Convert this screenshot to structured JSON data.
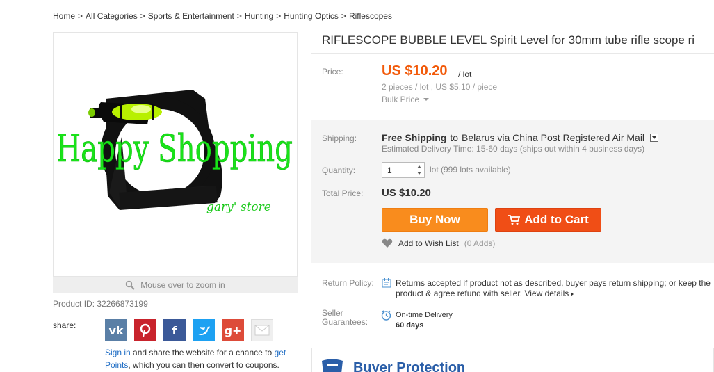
{
  "breadcrumb": [
    "Home",
    "All Categories",
    "Sports & Entertainment",
    "Hunting",
    "Hunting Optics",
    "Riflescopes"
  ],
  "breadcrumb_separator": ">",
  "product": {
    "image_text_main": "Happy Shopping",
    "image_text_sub": "gary' store",
    "zoom_hint": "Mouse over to zoom in",
    "product_id": "Product ID: 32266873199",
    "title": "RIFLESCOPE BUBBLE LEVEL Spirit Level for 30mm tube rifle scope ri"
  },
  "share": {
    "label": "share:",
    "icons": [
      "vk-icon",
      "pinterest-icon",
      "facebook-icon",
      "twitter-icon",
      "googleplus-icon",
      "mail-icon"
    ],
    "signin_link": "Sign in",
    "mid_text": "and share the website for a chance to",
    "get_points_link": "get Points",
    "tail_text": ", which you can then convert to coupons."
  },
  "price": {
    "label": "Price:",
    "value": "US $10.20",
    "unit": "/ lot",
    "lot_info": "2 pieces / lot , US $5.10 / piece",
    "bulk": "Bulk Price"
  },
  "shipping": {
    "label": "Shipping:",
    "free": "Free Shipping",
    "to": "to",
    "dest": "Belarus via China Post Registered Air Mail",
    "estimate": "Estimated Delivery Time: 15-60 days (ships out within 4 business days)"
  },
  "quantity": {
    "label": "Quantity:",
    "value": "1",
    "available": "lot (999 lots available)"
  },
  "total": {
    "label": "Total Price:",
    "value": "US $10.20"
  },
  "actions": {
    "buy_now": "Buy Now",
    "add_to_cart": "Add to Cart",
    "wishlist": "Add to Wish List",
    "wishlist_count": "(0 Adds)"
  },
  "return_policy": {
    "label": "Return Policy:",
    "text": "Returns accepted if product not as described, buyer pays return shipping; or keep the product & agree refund with seller.",
    "details_link": "View details"
  },
  "seller_guarantees": {
    "label_line1": "Seller",
    "label_line2": "Guarantees:",
    "item": "On-time Delivery",
    "days": "60 days"
  },
  "buyer_protection": {
    "title": "Buyer Protection"
  },
  "colors": {
    "price": "#f25a0a",
    "buy_now": "#f98c1d",
    "add_to_cart": "#f04e16",
    "link": "#1c6bc4",
    "protection": "#2a5ea8"
  }
}
